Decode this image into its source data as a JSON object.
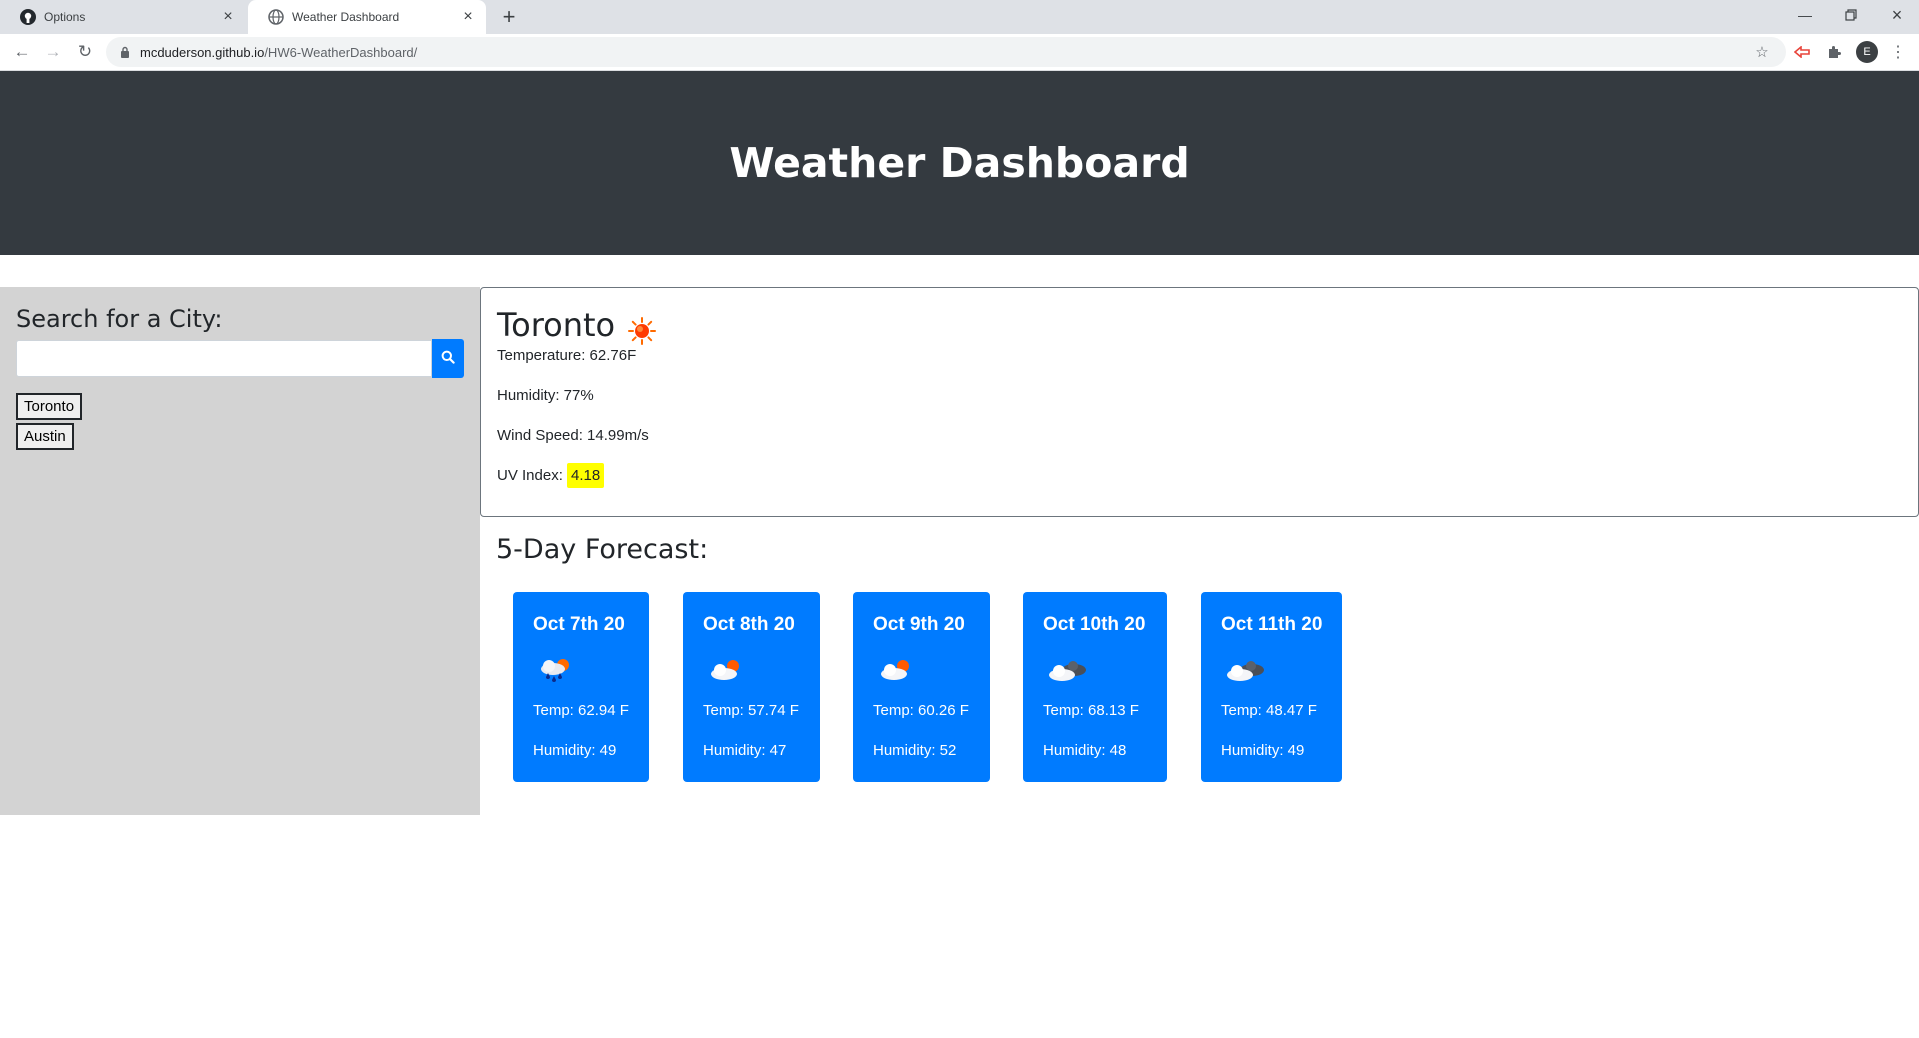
{
  "browser": {
    "tabs": [
      {
        "title": "Options",
        "icon": "github-icon"
      },
      {
        "title": "Weather Dashboard",
        "icon": "globe-icon"
      }
    ],
    "url_host": "mcduderson.github.io",
    "url_path": "/HW6-WeatherDashboard/",
    "avatar_initial": "E"
  },
  "page": {
    "title": "Weather Dashboard",
    "colors": {
      "header": "#343a40",
      "sidebar": "#d3d3d3",
      "primary": "#007bff",
      "uv": "#ffff00"
    }
  },
  "search": {
    "heading": "Search for a City:",
    "value": "",
    "placeholder": "",
    "history": [
      "Toronto",
      "Austin"
    ]
  },
  "current": {
    "city": "Toronto",
    "icon": "sun-icon",
    "temperature": "Temperature: 62.76F",
    "humidity": "Humidity: 77%",
    "wind": "Wind Speed: 14.99m/s",
    "uv_label": "UV Index:",
    "uv_value": "4.18"
  },
  "forecast": {
    "heading": "5-Day Forecast:",
    "days": [
      {
        "date": "Oct 7th 20",
        "icon": "rain-sun-icon",
        "temp": "Temp: 62.94 F",
        "humidity": "Humidity: 49"
      },
      {
        "date": "Oct 8th 20",
        "icon": "sun-cloud-icon",
        "temp": "Temp: 57.74 F",
        "humidity": "Humidity: 47"
      },
      {
        "date": "Oct 9th 20",
        "icon": "sun-cloud-icon",
        "temp": "Temp: 60.26 F",
        "humidity": "Humidity: 52"
      },
      {
        "date": "Oct 10th 20",
        "icon": "clouds-icon",
        "temp": "Temp: 68.13 F",
        "humidity": "Humidity: 48"
      },
      {
        "date": "Oct 11th 20",
        "icon": "clouds-icon",
        "temp": "Temp: 48.47 F",
        "humidity": "Humidity: 49"
      }
    ]
  }
}
